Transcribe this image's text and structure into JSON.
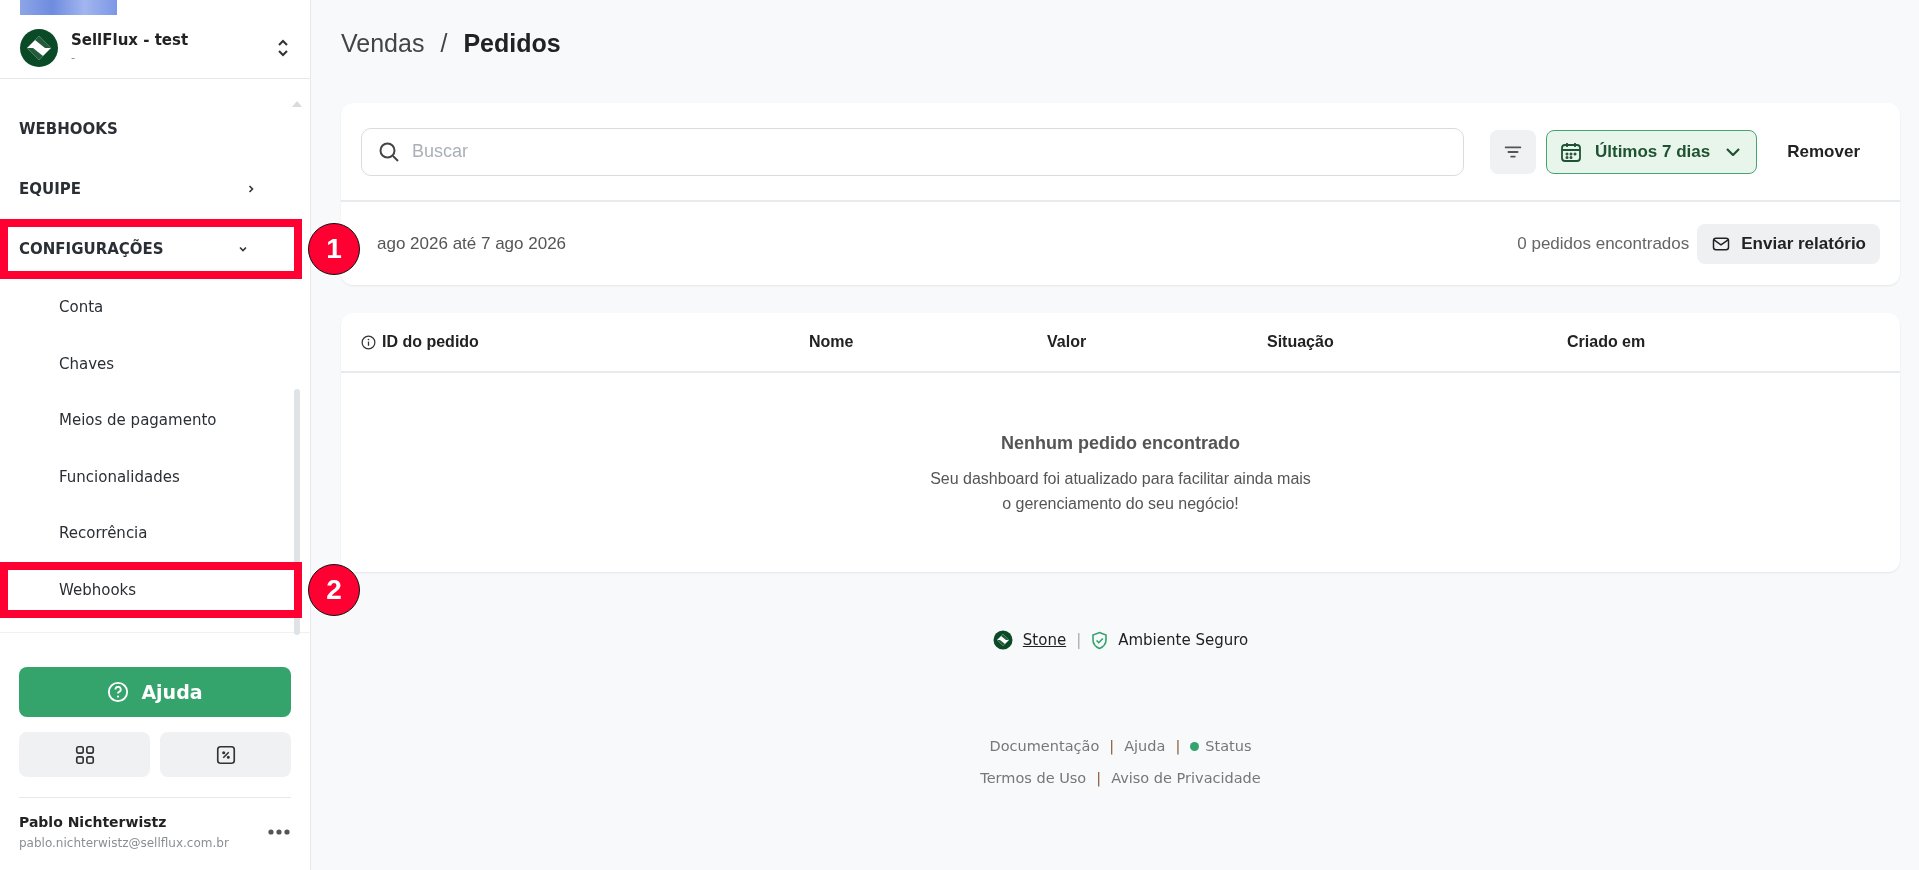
{
  "sidebar": {
    "account": {
      "name": "SellFlux - test",
      "subtitle": "-"
    },
    "nav": [
      {
        "label": "WEBHOOKS",
        "kind": "link"
      },
      {
        "label": "EQUIPE",
        "kind": "group",
        "expanded": false
      },
      {
        "label": "CONFIGURAÇÕES",
        "kind": "group",
        "expanded": true,
        "annotation": "1",
        "children": [
          {
            "label": "Conta"
          },
          {
            "label": "Chaves"
          },
          {
            "label": "Meios de pagamento"
          },
          {
            "label": "Funcionalidades"
          },
          {
            "label": "Recorrência"
          },
          {
            "label": "Webhooks",
            "annotation": "2"
          }
        ]
      }
    ],
    "help_button": "Ajuda",
    "user": {
      "name": "Pablo Nichterwistz",
      "email": "pablo.nichterwistz@sellflux.com.br"
    }
  },
  "breadcrumb": {
    "separator": "/",
    "items": [
      {
        "label": "Vendas",
        "current": false
      },
      {
        "label": "Pedidos",
        "current": true
      }
    ]
  },
  "filters": {
    "search": {
      "placeholder": "Buscar"
    },
    "period": "Últimos 7 dias",
    "remove": "Remover"
  },
  "summary": {
    "range": "ago 2026 até 7 ago 2026",
    "count": "0 pedidos encontrados",
    "report_button": "Enviar relatório"
  },
  "table": {
    "columns": [
      {
        "label": "ID do pedido",
        "info": true
      },
      {
        "label": "Nome",
        "info": false
      },
      {
        "label": "Valor",
        "info": false
      },
      {
        "label": "Situação",
        "info": false
      },
      {
        "label": "Criado em",
        "info": false
      }
    ],
    "empty": {
      "title": "Nenhum pedido encontrado",
      "lines": [
        "Seu dashboard foi atualizado para facilitar ainda mais",
        "o gerenciamento do seu negócio!"
      ]
    }
  },
  "footer": {
    "brand": "Stone",
    "secure": "Ambiente Seguro",
    "separator": "|",
    "link_rows": [
      [
        {
          "label": "Documentação",
          "kind": "link"
        },
        {
          "label": "Ajuda",
          "kind": "link"
        },
        {
          "label": "Status",
          "kind": "status"
        }
      ],
      [
        {
          "label": "Termos de Uso",
          "kind": "link"
        },
        {
          "label": "Aviso de Privacidade",
          "kind": "link"
        }
      ]
    ]
  }
}
